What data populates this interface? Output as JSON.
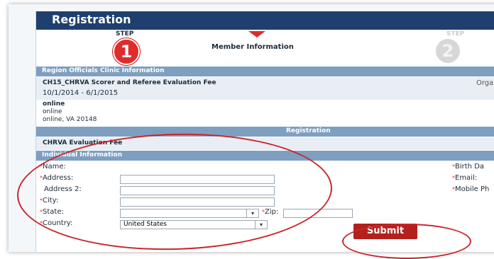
{
  "header": {
    "title": "Registration"
  },
  "steps": {
    "step_label": "STEP",
    "step1_number": "1",
    "step2_label": "STEP",
    "step2_number": "2",
    "current_step_title": "Member Information"
  },
  "sections": {
    "region_title": "Region Officials Clinic Information",
    "event_name": "CH15_CHRVA Scorer and Referee Evaluation Fee",
    "org_label": "Orga",
    "dates": "10/1/2014 - 6/1/2015",
    "location_title": "online",
    "location_line1": "online",
    "location_line2": "online, VA 20148",
    "registration_header": "Registration",
    "registration_item": "CHRVA Evaluation Fee",
    "individual_title": "Individual Information"
  },
  "form": {
    "name_label": "Name:",
    "address_label": "Address:",
    "address2_label": "Address 2:",
    "city_label": "City:",
    "state_label": "State:",
    "zip_label": "Zip:",
    "country_label": "Country:",
    "country_value": "United States",
    "birth_label": "Birth Da",
    "email_label": "Email:",
    "mobile_label": "Mobile Ph"
  },
  "actions": {
    "submit_label": "Submit"
  },
  "colors": {
    "header_bg": "#1f3f6e",
    "accent_red": "#e02b2b",
    "bar_bg": "#7e9fbf",
    "annotation_red": "#c9262c"
  }
}
